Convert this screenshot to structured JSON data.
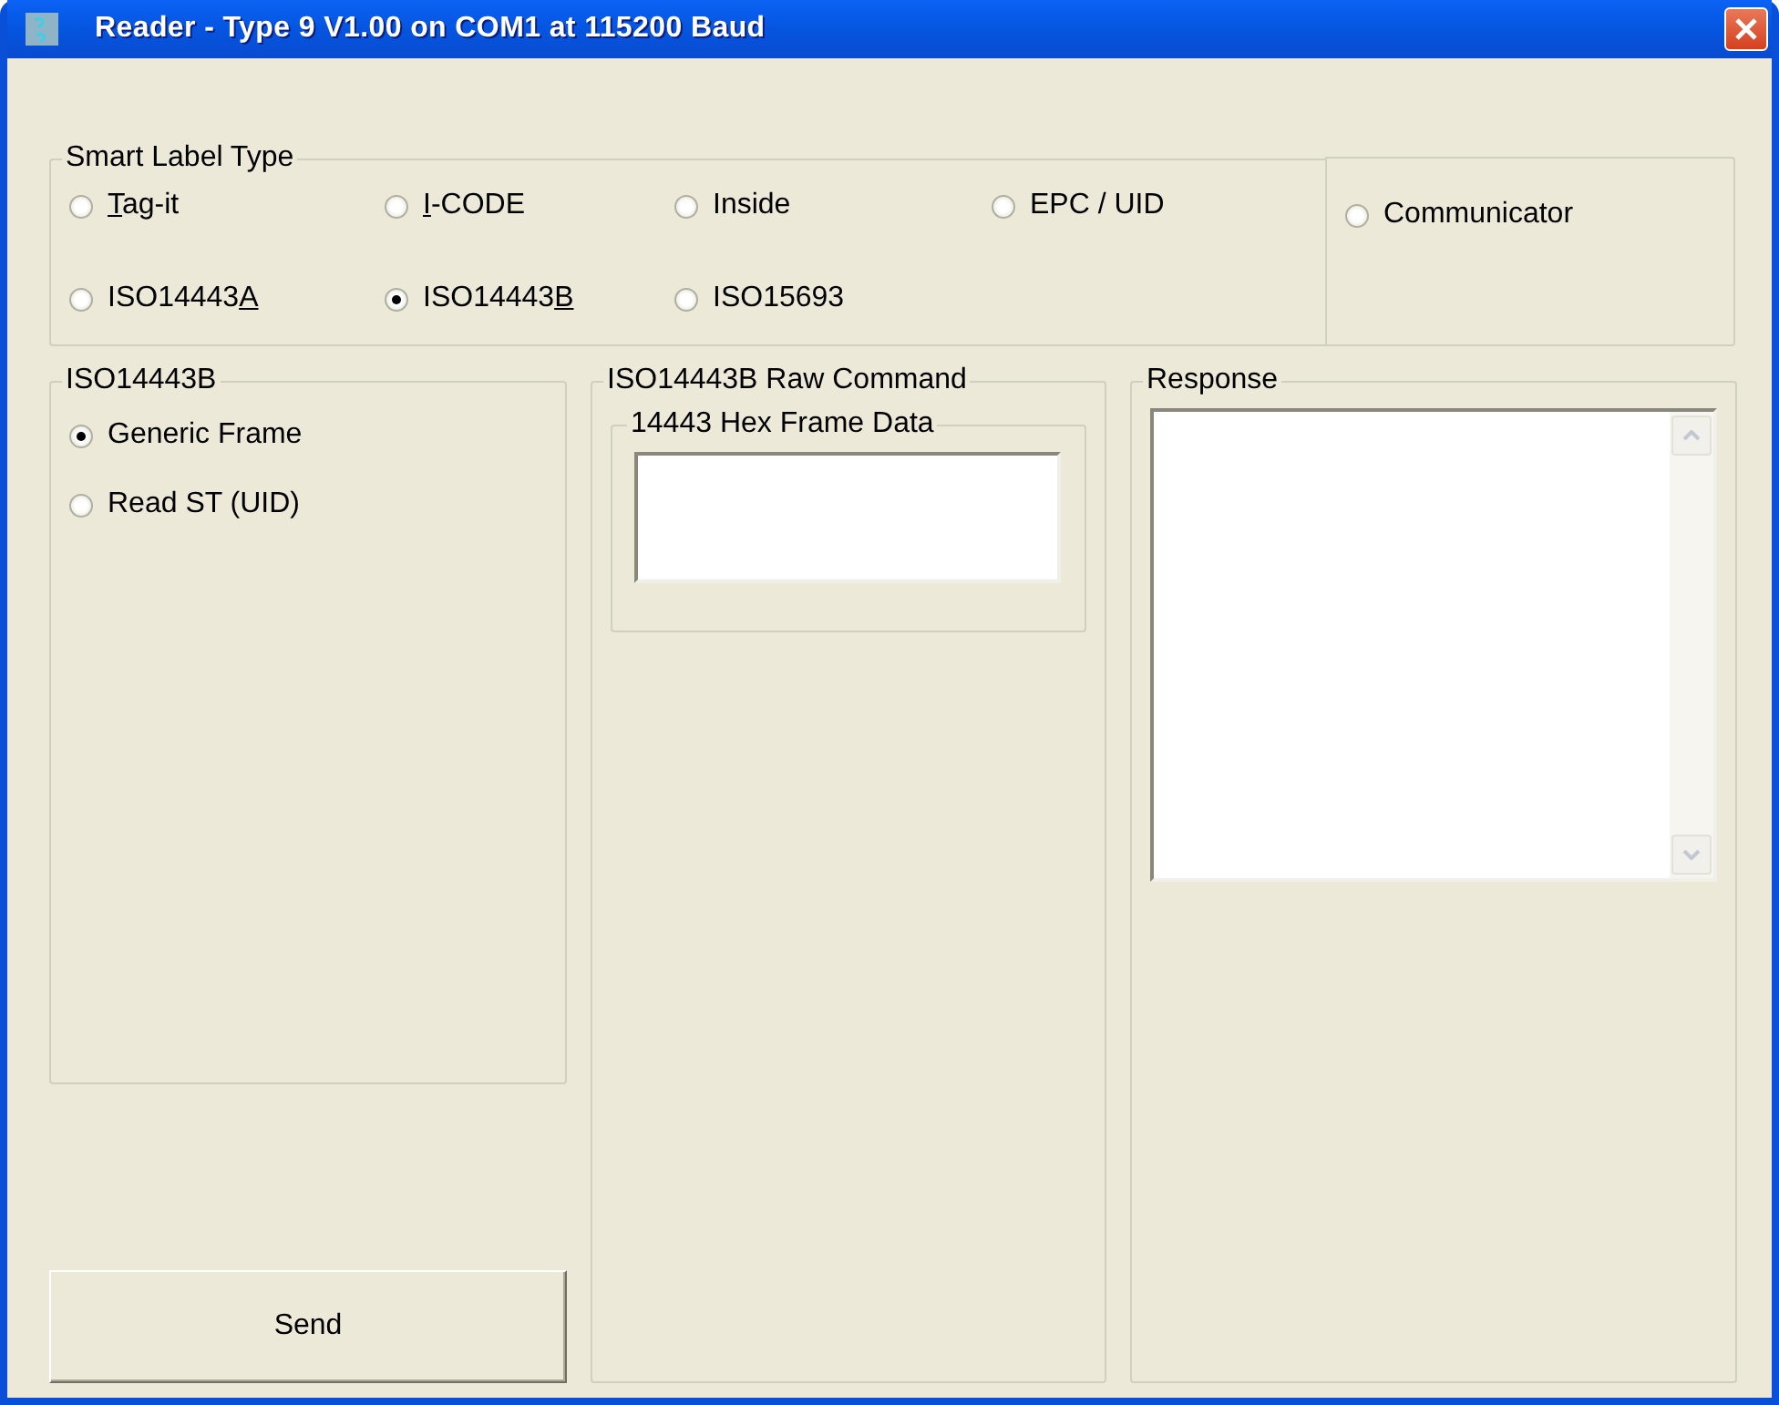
{
  "window": {
    "title": "Reader - Type 9 V1.00 on COM1 at 115200 Baud"
  },
  "smart_label_type": {
    "title": "Smart Label Type",
    "options": [
      {
        "segments": [
          {
            "text": "T",
            "underline": true
          },
          {
            "text": "ag-it"
          }
        ],
        "selected": false
      },
      {
        "segments": [
          {
            "text": "I",
            "underline": true
          },
          {
            "text": "-CODE"
          }
        ],
        "selected": false
      },
      {
        "segments": [
          {
            "text": "Inside"
          }
        ],
        "selected": false
      },
      {
        "segments": [
          {
            "text": "EPC / UID"
          }
        ],
        "selected": false
      },
      {
        "segments": [
          {
            "text": "ISO14443"
          },
          {
            "text": "A",
            "underline": true
          }
        ],
        "selected": false
      },
      {
        "segments": [
          {
            "text": "ISO14443"
          },
          {
            "text": "B",
            "underline": true
          }
        ],
        "selected": true
      },
      {
        "segments": [
          {
            "text": "ISO15693"
          }
        ],
        "selected": false
      }
    ],
    "side_options": [
      {
        "segments": [
          {
            "text": "Communicator"
          }
        ],
        "selected": false
      }
    ]
  },
  "mode_group": {
    "title": "ISO14443B",
    "options": [
      {
        "segments": [
          {
            "text": "Generic Frame"
          }
        ],
        "selected": true
      },
      {
        "segments": [
          {
            "text": "Read ST (UID)"
          }
        ],
        "selected": false
      }
    ]
  },
  "raw_command": {
    "title": "ISO14443B Raw Command",
    "hex_frame": {
      "title": "14443 Hex Frame Data"
    }
  },
  "response": {
    "title": "Response"
  },
  "send_button": {
    "label": "Send"
  }
}
